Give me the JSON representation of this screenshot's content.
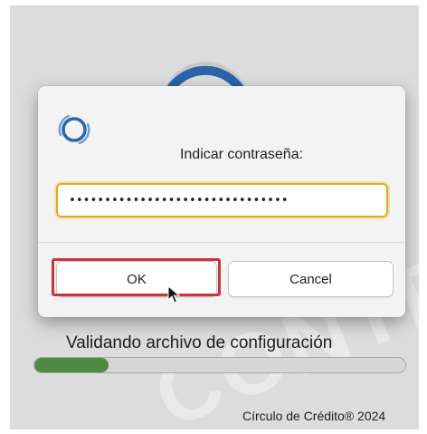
{
  "dialog": {
    "title": "Indicar contraseña:",
    "password_value": "•••••••••••••••••••••••••••••••",
    "ok_label": "OK",
    "cancel_label": "Cancel"
  },
  "background": {
    "status_text": "Validando archivo de configuración",
    "progress_fraction": 0.2,
    "watermark_text": "CONTRO",
    "copyright": "Círculo de Crédito® 2024"
  },
  "icons": {
    "dialog_icon": "app-ring-icon",
    "loader": "spinner-icon",
    "cursor": "mouse-pointer-icon"
  },
  "colors": {
    "accent_focus": "#e4a91b",
    "highlight": "#c9353c",
    "progress": "#4f8a42",
    "ring_blue": "#2b64ab"
  }
}
